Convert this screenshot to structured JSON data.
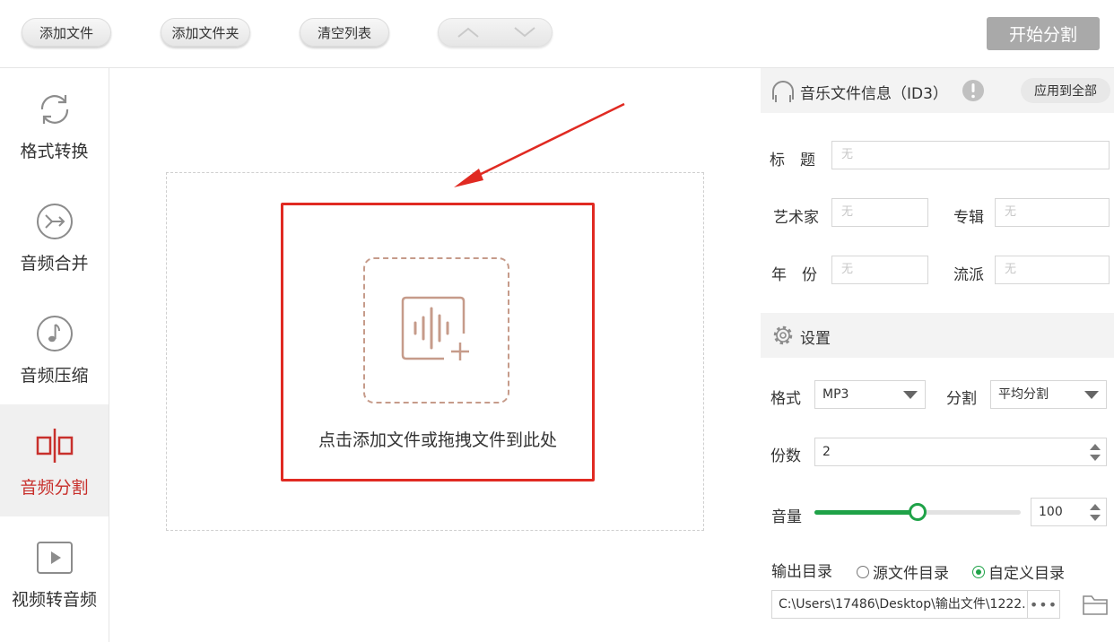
{
  "toolbar": {
    "add_file": "添加文件",
    "add_folder": "添加文件夹",
    "clear_list": "清空列表",
    "move_up_icon": "chevron-up-icon",
    "move_down_icon": "chevron-down-icon",
    "start": "开始分割",
    "start_color": "#a9a9a9"
  },
  "sidebar": {
    "active_color": "#c8302c",
    "items": [
      {
        "label": "格式转换",
        "icon": "refresh-cycle-icon",
        "active": false
      },
      {
        "label": "音频合并",
        "icon": "merge-arrows-icon",
        "active": false
      },
      {
        "label": "音频压缩",
        "icon": "music-note-icon",
        "active": false
      },
      {
        "label": "音频分割",
        "icon": "split-audio-icon",
        "active": true
      },
      {
        "label": "视频转音频",
        "icon": "play-video-icon",
        "active": false
      }
    ]
  },
  "dropzone": {
    "hint": "点击添加文件或拖拽文件到此处",
    "icon": "audio-wave-add-icon",
    "highlight_color": "#e02a22"
  },
  "id3": {
    "title": "音乐文件信息（ID3）",
    "header_icon": "headphones-icon",
    "info_icon": "info-exclamation-icon",
    "apply_all": "应用到全部",
    "fields": {
      "title_label": "标　题",
      "title_placeholder": "无",
      "artist_label": "艺术家",
      "artist_placeholder": "无",
      "album_label": "专辑",
      "album_placeholder": "无",
      "year_label": "年　份",
      "year_placeholder": "无",
      "genre_label": "流派",
      "genre_placeholder": "无"
    }
  },
  "settings": {
    "title": "设置",
    "header_icon": "gear-icon",
    "format_label": "格式",
    "format_value": "MP3",
    "split_label": "分割",
    "split_value": "平均分割",
    "parts_label": "份数",
    "parts_value": "2",
    "volume_label": "音量",
    "volume_value": "100",
    "volume_fraction": 0.5,
    "accent_color": "#1fa248",
    "output_label": "输出目录",
    "output_options": [
      "源文件目录",
      "自定义目录"
    ],
    "output_selected": 1,
    "output_path": "C:\\Users\\17486\\Desktop\\输出文件\\1222.",
    "more_button": "•••",
    "folder_icon": "folder-icon"
  }
}
